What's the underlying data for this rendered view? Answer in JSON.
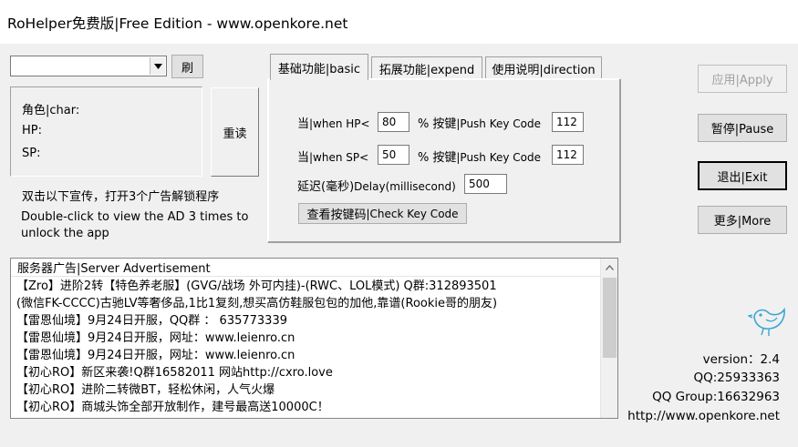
{
  "window": {
    "title": "RoHelper免费版|Free Edition - www.openkore.net"
  },
  "top": {
    "char_select_value": "",
    "refresh_label": "刷"
  },
  "char_box": {
    "char_label": "角色|char:",
    "hp_label": "HP:",
    "sp_label": "SP:",
    "reload_label": "重读"
  },
  "promo": {
    "cn": "双击以下宣传，打开3个广告解锁程序",
    "en": "Double-click to view the AD 3 times to unlock the app"
  },
  "tabs": [
    {
      "label": "基础功能|basic",
      "active": true
    },
    {
      "label": "拓展功能|expend",
      "active": false
    },
    {
      "label": "使用说明|direction",
      "active": false
    }
  ],
  "basic": {
    "hp_prefix": "当",
    "hp_when": "|when HP<",
    "hp_value": "80",
    "hp_percent": "%",
    "hp_key_cn": "按键",
    "hp_key_en": "|Push Key Code",
    "hp_key_value": "112",
    "sp_prefix": "当",
    "sp_when": "|when SP<",
    "sp_value": "50",
    "sp_percent": "%",
    "sp_key_cn": "按键",
    "sp_key_en": "|Push Key Code",
    "sp_key_value": "112",
    "delay_cn": "延迟(毫秒)",
    "delay_en": "Delay(millisecond)",
    "delay_value": "500",
    "check_cn": "查看按键码",
    "check_en": "|Check Key Code"
  },
  "right_buttons": {
    "apply": "应用|Apply",
    "pause": "暂停|Pause",
    "exit": "退出|Exit",
    "more": "更多|More"
  },
  "ads": {
    "header": "服务器广告|Server Advertisement",
    "rows": [
      "【Zro】进阶2转【特色养老服】(GVG/战场 外可内挂)-(RWC、LOL模式) Q群:312893501",
      "(微信FK-CCCC)古驰LV等奢侈品,1比1复刻,想买高仿鞋服包包的加他,靠谱(Rookie哥的朋友)",
      "【雷恩仙境】9月24日开服，QQ群 ： 635773339",
      "【雷恩仙境】9月24日开服，网址：www.leienro.cn",
      "【雷恩仙境】9月24日开服，网址：www.leienro.cn",
      "【初心RO】新区来袭!Q群16582011 网站http://cxro.love",
      "【初心RO】进阶二转微BT，轻松休闲，人气火爆",
      "【初心RO】商城头饰全部开放制作，建号最高送10000C！"
    ]
  },
  "info": {
    "version": "version：2.4",
    "qq": "QQ:25933363",
    "qq_group": "QQ Group:16632963",
    "website": "http://www.openkore.net"
  },
  "colors": {
    "bird": "#3aa6d4"
  }
}
